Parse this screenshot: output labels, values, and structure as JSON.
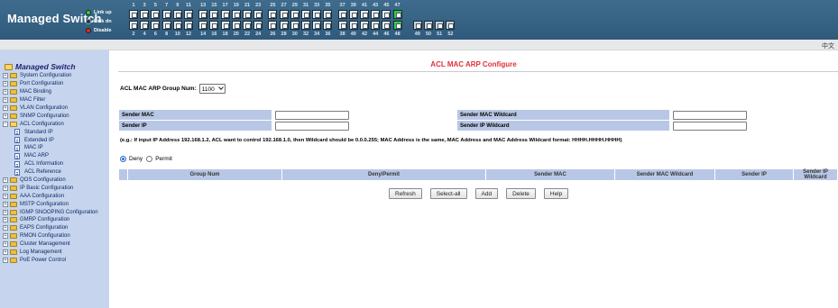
{
  "header": {
    "brand": "Managed Switch",
    "legend": [
      {
        "icon": "green-dot-icon",
        "label": "Link up",
        "color": "#32d23a"
      },
      {
        "icon": "dark-dot-icon",
        "label": "Link dn",
        "color": "#203040"
      },
      {
        "icon": "red-dot-icon",
        "label": "Disable",
        "color": "#e02a1e"
      }
    ],
    "ports_top": [
      "1",
      "3",
      "5",
      "7",
      "9",
      "11",
      "13",
      "15",
      "17",
      "19",
      "21",
      "23",
      "25",
      "27",
      "29",
      "31",
      "33",
      "35",
      "37",
      "39",
      "41",
      "43",
      "45",
      "47"
    ],
    "ports_bottom": [
      "2",
      "4",
      "6",
      "8",
      "10",
      "12",
      "14",
      "16",
      "18",
      "20",
      "22",
      "24",
      "26",
      "28",
      "30",
      "32",
      "34",
      "36",
      "38",
      "40",
      "42",
      "44",
      "46",
      "48",
      "49",
      "50",
      "51",
      "52"
    ],
    "link_up_ports": [
      "47",
      "48"
    ],
    "language": "中文"
  },
  "sidebar": {
    "root": "Managed Switch",
    "items": [
      {
        "label": "System Configuration",
        "expander": "+"
      },
      {
        "label": "Port Configuration",
        "expander": "+"
      },
      {
        "label": "MAC Binding",
        "expander": "+"
      },
      {
        "label": "MAC Filter",
        "expander": "+"
      },
      {
        "label": "VLAN Configuration",
        "expander": "+"
      },
      {
        "label": "SNMP Configuration",
        "expander": "+"
      },
      {
        "label": "ACL Configuration",
        "expander": "−"
      }
    ],
    "acl_children": [
      "Standard IP",
      "Extended IP",
      "MAC IP",
      "MAC ARP",
      "ACL Information",
      "ACL Reference"
    ],
    "items_after": [
      {
        "label": "QOS Configuration",
        "expander": "+"
      },
      {
        "label": "IP Basic Configuration",
        "expander": "+"
      },
      {
        "label": "AAA Configuration",
        "expander": "+"
      },
      {
        "label": "MSTP Configuration",
        "expander": "+"
      },
      {
        "label": "IGMP SNOOPING Configuration",
        "expander": "+"
      },
      {
        "label": "GMRP Configuration",
        "expander": "+"
      },
      {
        "label": "EAPS Configuration",
        "expander": "+"
      },
      {
        "label": "RMON Configuration",
        "expander": "+"
      },
      {
        "label": "Cluster Management",
        "expander": "+"
      },
      {
        "label": "Log Management",
        "expander": "+"
      },
      {
        "label": "PoE Power Control",
        "expander": "+"
      }
    ]
  },
  "main": {
    "title": "ACL MAC ARP Configure",
    "group_label": "ACL MAC ARP Group Num:",
    "group_value": "1100",
    "fields": {
      "sender_mac": "Sender MAC",
      "sender_mac_wildcard": "Sender MAC Wildcard",
      "sender_ip": "Sender IP",
      "sender_ip_wildcard": "Sender IP Wildcard"
    },
    "values": {
      "sender_mac": "",
      "sender_mac_wildcard": "",
      "sender_ip": "",
      "sender_ip_wildcard": ""
    },
    "hint": "(e.g.: If input IP Address 192.168.1.2, ACL want to control 192.168.1.0, then Wildcard should be 0.0.0.255; MAC Address is the same, MAC Address and MAC Address Wildcard format: HHHH.HHHH.HHHH)",
    "radio_deny": "Deny",
    "radio_permit": "Permit",
    "radio_selected": "Deny",
    "columns": [
      "Group Num",
      "Deny/Permit",
      "Sender MAC",
      "Sender MAC Wildcard",
      "Sender IP",
      "Sender IP Wildcard"
    ],
    "buttons": {
      "refresh": "Refresh",
      "select_all": "Select-all",
      "add": "Add",
      "delete": "Delete",
      "help": "Help"
    }
  }
}
